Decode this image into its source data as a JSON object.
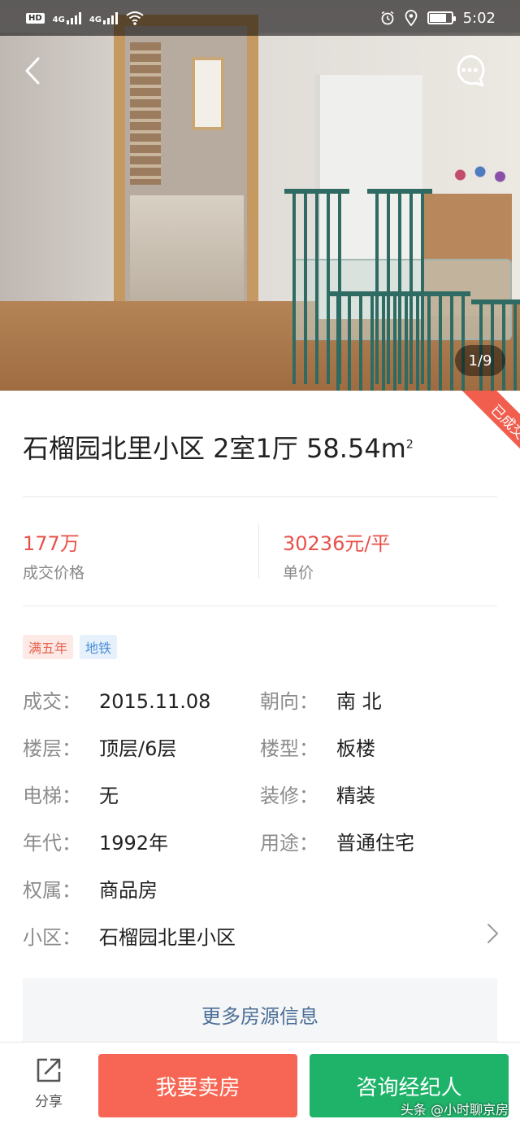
{
  "status_bar": {
    "hd_label": "HD",
    "net_1": "4G",
    "net_2": "4G",
    "time": "5:02"
  },
  "photo": {
    "counter": "1/9"
  },
  "ribbon": {
    "label": "已成交"
  },
  "listing": {
    "title": "石榴园北里小区 2室1厅 58.54㎡",
    "title_main": "石榴园北里小区 2室1厅 58.54m",
    "title_sup": "2"
  },
  "prices": {
    "deal_price": "177万",
    "deal_price_label": "成交价格",
    "unit_price": "30236元/平",
    "unit_price_label": "单价"
  },
  "tags": [
    {
      "label": "满五年",
      "color": "#e6644f"
    },
    {
      "label": "地铁",
      "color": "#4a8ed6"
    }
  ],
  "attributes": {
    "deal": {
      "key": "成交：",
      "value": "2015.11.08"
    },
    "orientation": {
      "key": "朝向：",
      "value": "南 北"
    },
    "floor": {
      "key": "楼层：",
      "value": "顶层/6层"
    },
    "building_type": {
      "key": "楼型：",
      "value": "板楼"
    },
    "elevator": {
      "key": "电梯：",
      "value": "无"
    },
    "decoration": {
      "key": "装修：",
      "value": "精装"
    },
    "year": {
      "key": "年代：",
      "value": "1992年"
    },
    "usage": {
      "key": "用途：",
      "value": "普通住宅"
    },
    "ownership": {
      "key": "权属：",
      "value": "商品房"
    },
    "community": {
      "key": "小区：",
      "value": "石榴园北里小区"
    }
  },
  "more_info_button": "更多房源信息",
  "bottom_bar": {
    "share_label": "分享",
    "sell_button": "我要卖房",
    "agent_button": "咨询经纪人"
  },
  "watermark": "头条 @小时聊京房",
  "colors": {
    "accent_red": "#e8504a",
    "sell_button": "#f76654",
    "agent_button": "#1fb36a",
    "link_blue": "#4b6f98",
    "ribbon": "#f25e4e"
  },
  "icons": [
    "back-icon",
    "chat-bubble-icon",
    "share-icon",
    "chevron-right-icon",
    "alarm-icon",
    "location-icon",
    "wifi-icon",
    "battery-icon"
  ]
}
